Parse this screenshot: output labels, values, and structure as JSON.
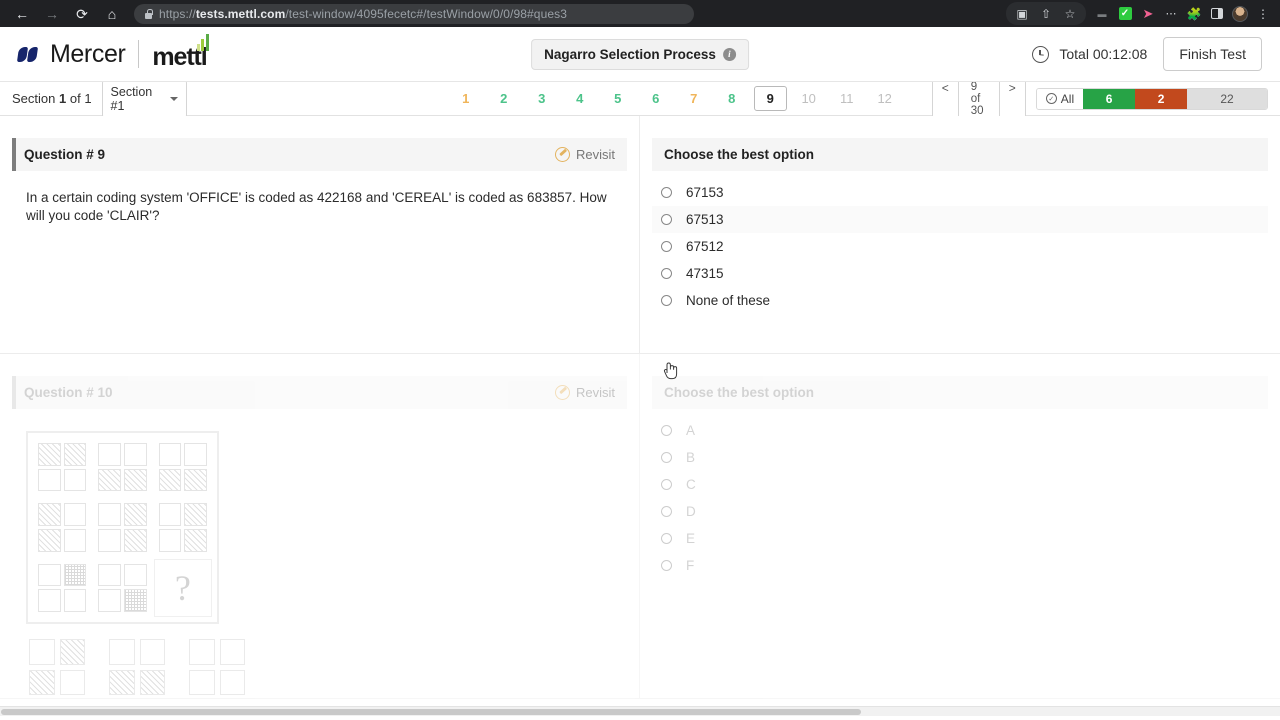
{
  "browser": {
    "url_prefix": "https://",
    "url_domain": "tests.mettl.com",
    "url_path": "/test-window/4095fecetc#/testWindow/0/0/98#ques3",
    "back_icon": "back-arrow-icon",
    "forward_icon": "forward-arrow-icon",
    "reload_icon": "reload-icon",
    "home_icon": "home-icon",
    "lock_icon": "lock-icon",
    "toolbar_icons": [
      "video-camera-icon",
      "share-icon",
      "bookmark-star-icon",
      "small-badge-icon",
      "green-check-extension-icon",
      "pink-arrow-extension-icon",
      "dots-extension-icon",
      "puzzle-extensions-icon",
      "side-panel-icon",
      "profile-avatar-icon",
      "three-dot-menu-icon"
    ]
  },
  "header": {
    "logo_primary": "Mercer",
    "logo_secondary": "mettl",
    "test_name": "Nagarro Selection Process",
    "info_icon_glyph": "i",
    "timer_label": "Total 00:12:08",
    "finish_button": "Finish Test",
    "clock_icon": "clock-icon"
  },
  "section_bar": {
    "section_prefix": "Section",
    "section_number": "1",
    "section_suffix": "of 1",
    "section_select_value": "Section #1",
    "question_numbers": [
      {
        "label": "1",
        "state": "amber"
      },
      {
        "label": "2",
        "state": "green"
      },
      {
        "label": "3",
        "state": "green"
      },
      {
        "label": "4",
        "state": "green"
      },
      {
        "label": "5",
        "state": "green"
      },
      {
        "label": "6",
        "state": "green"
      },
      {
        "label": "7",
        "state": "amber"
      },
      {
        "label": "8",
        "state": "green"
      },
      {
        "label": "9",
        "state": "current"
      },
      {
        "label": "10",
        "state": "gray"
      },
      {
        "label": "11",
        "state": "gray"
      },
      {
        "label": "12",
        "state": "gray"
      }
    ],
    "pager_prev": "<",
    "pager_current": "9 of 30",
    "pager_next": ">",
    "status": {
      "all_label": "All",
      "all_icon": "check-circle-icon",
      "answered_count": "6",
      "review_count": "2",
      "unvisited_count": "22",
      "answered_color": "#27a346",
      "review_color": "#c2491d",
      "unvisited_color": "#dedede"
    }
  },
  "questions": [
    {
      "title": "Question # 9",
      "revisit_label": "Revisit",
      "revisit_icon": "revisit-pencil-icon",
      "body": "In a certain coding system 'OFFICE' is coded as 422168 and 'CEREAL'  is coded as 683857. How will you code 'CLAIR'?",
      "options_header": "Choose the best option",
      "options": [
        "67153",
        "67513",
        "67512",
        "47315",
        "None of these"
      ],
      "hovered_option_index": 1
    },
    {
      "title": "Question # 10",
      "revisit_label": "Revisit",
      "revisit_icon": "revisit-pencil-icon",
      "options_header": "Choose the best option",
      "options": [
        "A",
        "B",
        "C",
        "D",
        "E",
        "F"
      ],
      "figure_placeholder": "?"
    }
  ]
}
